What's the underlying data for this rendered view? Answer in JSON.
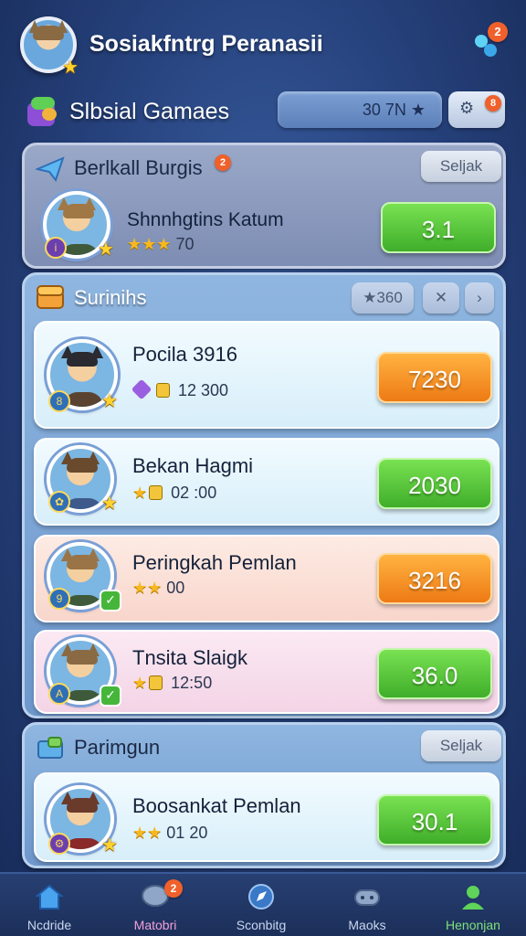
{
  "header": {
    "title": "Sosiakfntrg Peranasii",
    "notification_count": "2"
  },
  "games": {
    "title": "Slbsial Gamaes",
    "score": "30 7N ★",
    "settings_badge": "8",
    "settings_icon": "gear-icon"
  },
  "featured": {
    "title": "Berlkall Burgis",
    "title_badge": "2",
    "button_label": "Seljak",
    "player": {
      "name": "Shnnhgtins Katum",
      "stars": "★★★",
      "meta": "70",
      "action": "3.1"
    }
  },
  "rankings": {
    "title": "Surinihs",
    "filter_label": "★360",
    "rows": [
      {
        "name": "Pocila 3916",
        "meta": "12 300",
        "action": "7230",
        "icon": "gem-icon"
      },
      {
        "name": "Bekan Hagmi",
        "meta": "02 :00",
        "action": "2030",
        "icon": "star-icon"
      },
      {
        "name": "Peringkah Pemlan",
        "meta": "00",
        "action": "3216",
        "icon": "star-icon"
      },
      {
        "name": "Tnsita Slaigk",
        "meta": "12:50",
        "action": "36.0",
        "icon": "star-icon"
      }
    ]
  },
  "bottom_section": {
    "title": "Parimgun",
    "button_label": "Seljak",
    "player": {
      "name": "Boosankat Pemlan",
      "meta": "01 20",
      "action": "30.1"
    }
  },
  "nav": {
    "items": [
      {
        "label": "Ncdride",
        "icon": "home-icon",
        "color": "#c9d6ee"
      },
      {
        "label": "Matobri",
        "icon": "chat-icon",
        "color": "#f3a0d8",
        "badge": "2"
      },
      {
        "label": "Sconbitg",
        "icon": "compass-icon",
        "color": "#c9d6ee"
      },
      {
        "label": "Maoks",
        "icon": "gamepad-icon",
        "color": "#c9d6ee"
      },
      {
        "label": "Henonjan",
        "icon": "profile-icon",
        "color": "#7ee07a"
      }
    ]
  },
  "colors": {
    "green_button": "#4fc235",
    "orange_button": "#f38a1e",
    "background": "#2a4785"
  }
}
